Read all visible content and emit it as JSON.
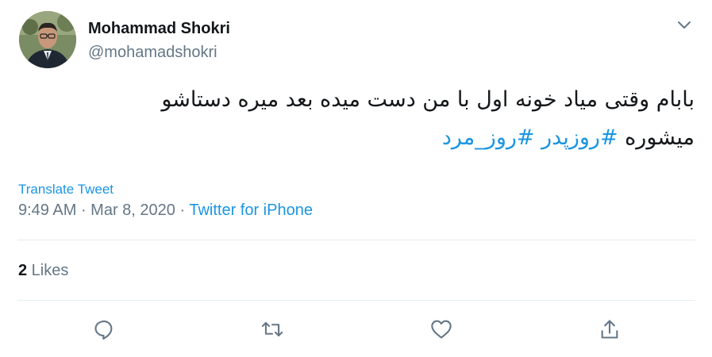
{
  "author": {
    "name": "Mohammad Shokri",
    "handle": "@mohamadshokri"
  },
  "tweet": {
    "line1": "بابام وقتی میاد خونه اول با من دست میده بعد میره دستاشو",
    "line2_text": "میشوره ",
    "hashtags": [
      "#روزپدر",
      "#روز_مرد"
    ]
  },
  "translate_label": "Translate Tweet",
  "meta": {
    "time": "9:49 AM",
    "separator": " · ",
    "date": "Mar 8, 2020",
    "source": "Twitter for iPhone"
  },
  "stats": {
    "likes_count": "2",
    "likes_label": " Likes"
  },
  "icons": {
    "menu": "chevron-down-icon",
    "reply": "reply-icon",
    "retweet": "retweet-icon",
    "like": "heart-icon",
    "share": "share-icon"
  },
  "colors": {
    "link": "#1b95e0",
    "secondary_text": "#657786",
    "primary_text": "#14171a",
    "divider": "#e6ecf0"
  }
}
